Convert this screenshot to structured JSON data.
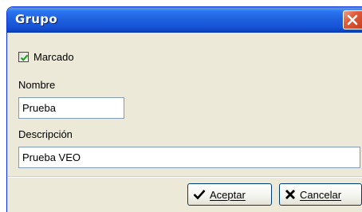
{
  "window": {
    "title": "Grupo"
  },
  "form": {
    "checkbox": {
      "label": "Marcado",
      "checked": true
    },
    "nombre": {
      "label": "Nombre",
      "value": "Prueba"
    },
    "descripcion": {
      "label": "Descripción",
      "value": "Prueba VEO"
    }
  },
  "buttons": {
    "accept_label": "Aceptar",
    "cancel_label": "Cancelar"
  },
  "icons": {
    "close": "close-icon",
    "accept": "checkmark-icon",
    "cancel": "x-icon"
  },
  "colors": {
    "titlebar": "#1f62de",
    "close_button": "#e05a3a",
    "dialog_background": "#ece9d8",
    "checkbox_check": "#21a121"
  }
}
